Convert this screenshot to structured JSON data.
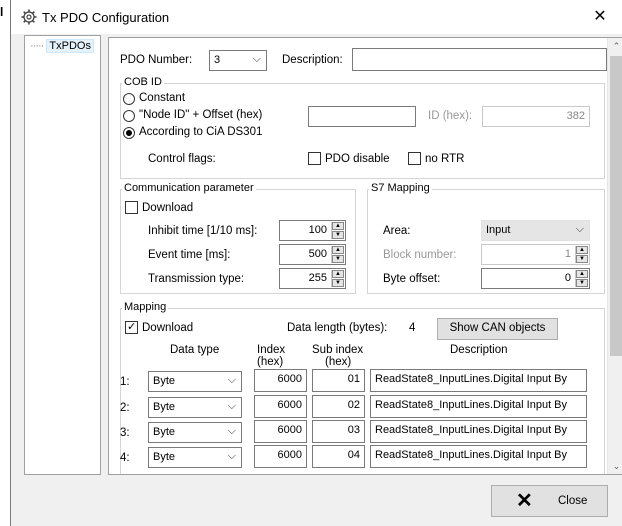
{
  "window": {
    "title": "Tx PDO Configuration"
  },
  "tree": {
    "items": [
      "TxPDOs"
    ]
  },
  "pdo": {
    "number_label": "PDO Number:",
    "number_value": "3",
    "description_label": "Description:",
    "description_value": ""
  },
  "cob_id": {
    "group_label": "COB ID",
    "constant_label": "Constant",
    "node_id_label": "\"Node ID\" + Offset (hex)",
    "offset_value": "",
    "according_label": "According to CiA DS301",
    "id_hex_label": "ID (hex):",
    "id_hex_value": "382",
    "control_flags_label": "Control flags:",
    "pdo_disable_label": "PDO disable",
    "no_rtr_label": "no RTR"
  },
  "comm": {
    "group_label": "Communication parameter",
    "download_label": "Download",
    "inhibit_label": "Inhibit time [1/10 ms]:",
    "inhibit_value": "100",
    "event_label": "Event time [ms]:",
    "event_value": "500",
    "transmission_label": "Transmission type:",
    "transmission_value": "255"
  },
  "s7": {
    "group_label": "S7 Mapping",
    "area_label": "Area:",
    "area_value": "Input",
    "block_label": "Block number:",
    "block_value": "1",
    "byte_offset_label": "Byte offset:",
    "byte_offset_value": "0"
  },
  "mapping": {
    "group_label": "Mapping",
    "download_label": "Download",
    "data_length_label": "Data length (bytes):",
    "data_length_value": "4",
    "show_can_label": "Show CAN objects",
    "col_type": "Data type",
    "col_index": "Index\n(hex)",
    "col_index_1": "Index",
    "col_index_2": "(hex)",
    "col_subindex_1": "Sub index",
    "col_subindex_2": "(hex)",
    "col_desc": "Description",
    "rows": [
      {
        "num": "1:",
        "type": "Byte",
        "index": "6000",
        "sub": "01",
        "desc": "ReadState8_InputLines.Digital Input By"
      },
      {
        "num": "2:",
        "type": "Byte",
        "index": "6000",
        "sub": "02",
        "desc": "ReadState8_InputLines.Digital Input By"
      },
      {
        "num": "3:",
        "type": "Byte",
        "index": "6000",
        "sub": "03",
        "desc": "ReadState8_InputLines.Digital Input By"
      },
      {
        "num": "4:",
        "type": "Byte",
        "index": "6000",
        "sub": "04",
        "desc": "ReadState8_InputLines.Digital Input By"
      }
    ]
  },
  "footer": {
    "close_label": "Close"
  }
}
